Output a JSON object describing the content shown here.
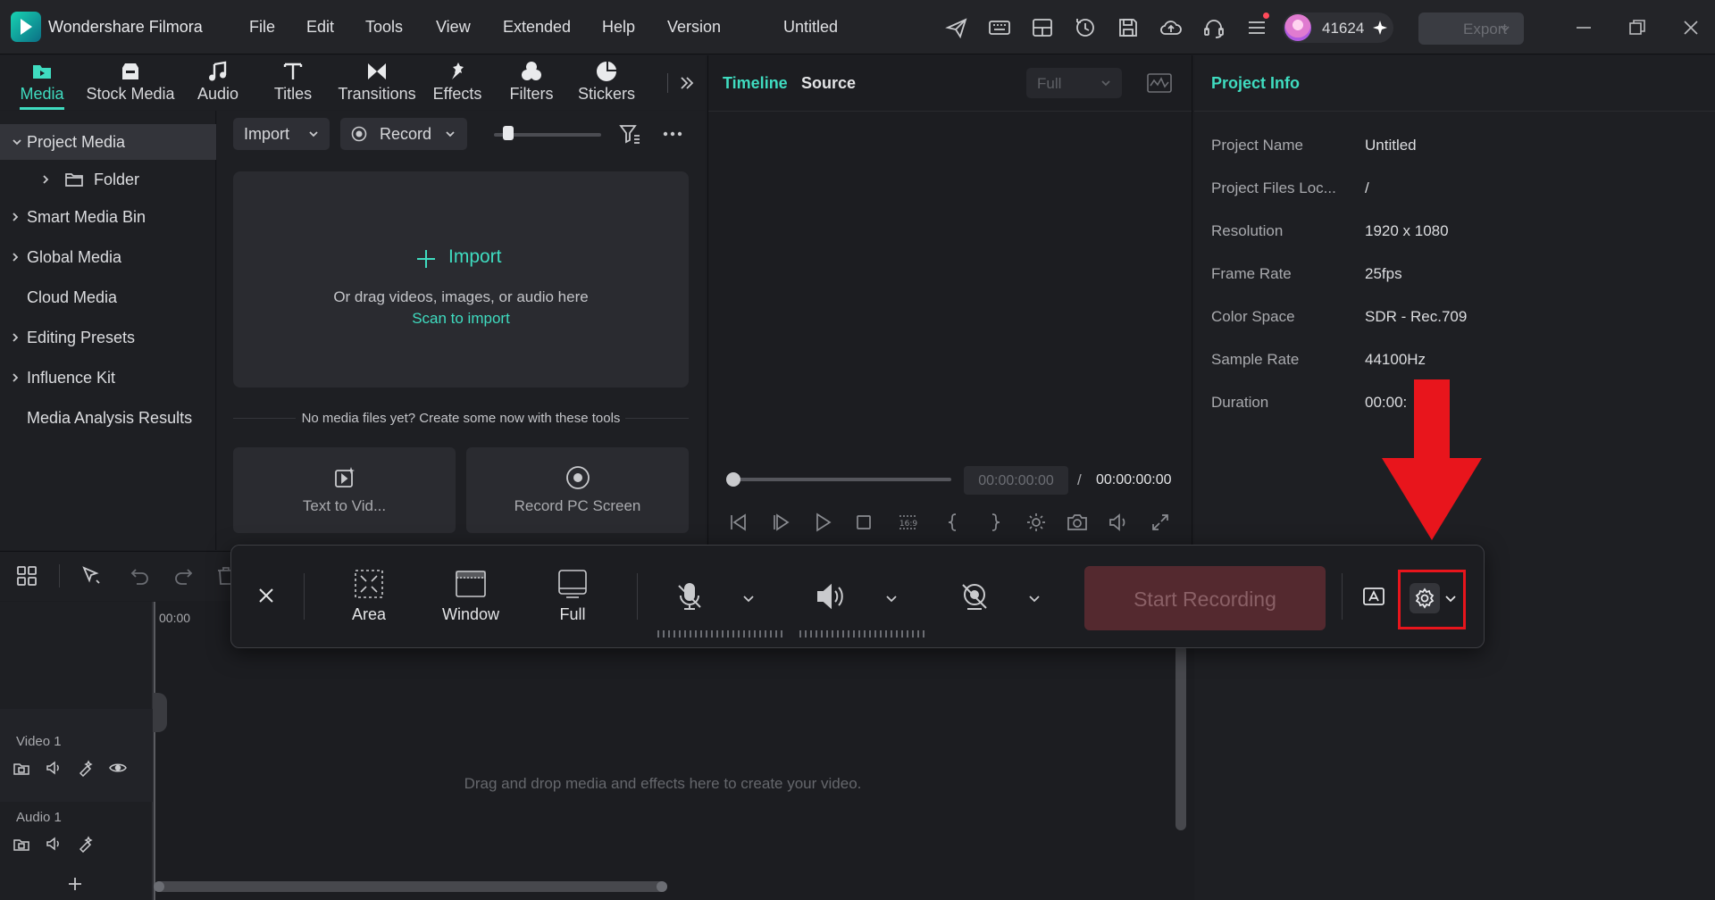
{
  "app": {
    "name": "Wondershare Filmora",
    "document_title": "Untitled",
    "user_credits": "41624",
    "export_label": "Export"
  },
  "menu": [
    "File",
    "Edit",
    "Tools",
    "View",
    "Extended",
    "Help",
    "Version"
  ],
  "media_tabs": [
    "Media",
    "Stock Media",
    "Audio",
    "Titles",
    "Transitions",
    "Effects",
    "Filters",
    "Stickers"
  ],
  "sidebar": {
    "items": [
      "Project Media",
      "Folder",
      "Smart Media Bin",
      "Global Media",
      "Cloud Media",
      "Editing Presets",
      "Influence Kit",
      "Media Analysis Results"
    ]
  },
  "media_toolbar": {
    "import_label": "Import",
    "record_label": "Record"
  },
  "drop_zone": {
    "import_label": "Import",
    "hint": "Or drag videos, images, or audio here",
    "scan_label": "Scan to import"
  },
  "no_media_text": "No media files yet? Create some now with these tools",
  "tool_cards": [
    "Text to Vid...",
    "Record PC Screen"
  ],
  "preview": {
    "tab_timeline": "Timeline",
    "tab_source": "Source",
    "quality": "Full",
    "time_current": "00:00:00:00",
    "time_separator": "/",
    "time_total": "00:00:00:00"
  },
  "project_info": {
    "title": "Project Info",
    "rows": [
      {
        "label": "Project Name",
        "value": "Untitled"
      },
      {
        "label": "Project Files Loc...",
        "value": "/"
      },
      {
        "label": "Resolution",
        "value": "1920 x 1080"
      },
      {
        "label": "Frame Rate",
        "value": "25fps"
      },
      {
        "label": "Color Space",
        "value": "SDR - Rec.709"
      },
      {
        "label": "Sample Rate",
        "value": "44100Hz"
      },
      {
        "label": "Duration",
        "value": "00:00:"
      }
    ]
  },
  "timeline": {
    "ruler_start": "00:00",
    "video_track": "Video 1",
    "audio_track": "Audio 1",
    "drop_hint": "Drag and drop media and effects here to create your video."
  },
  "recorder": {
    "modes": [
      "Area",
      "Window",
      "Full"
    ],
    "start_label": "Start Recording"
  },
  "colors": {
    "accent": "#3fdcc0",
    "highlight_box": "#e8151c",
    "start_recording_bg": "#54292f"
  }
}
